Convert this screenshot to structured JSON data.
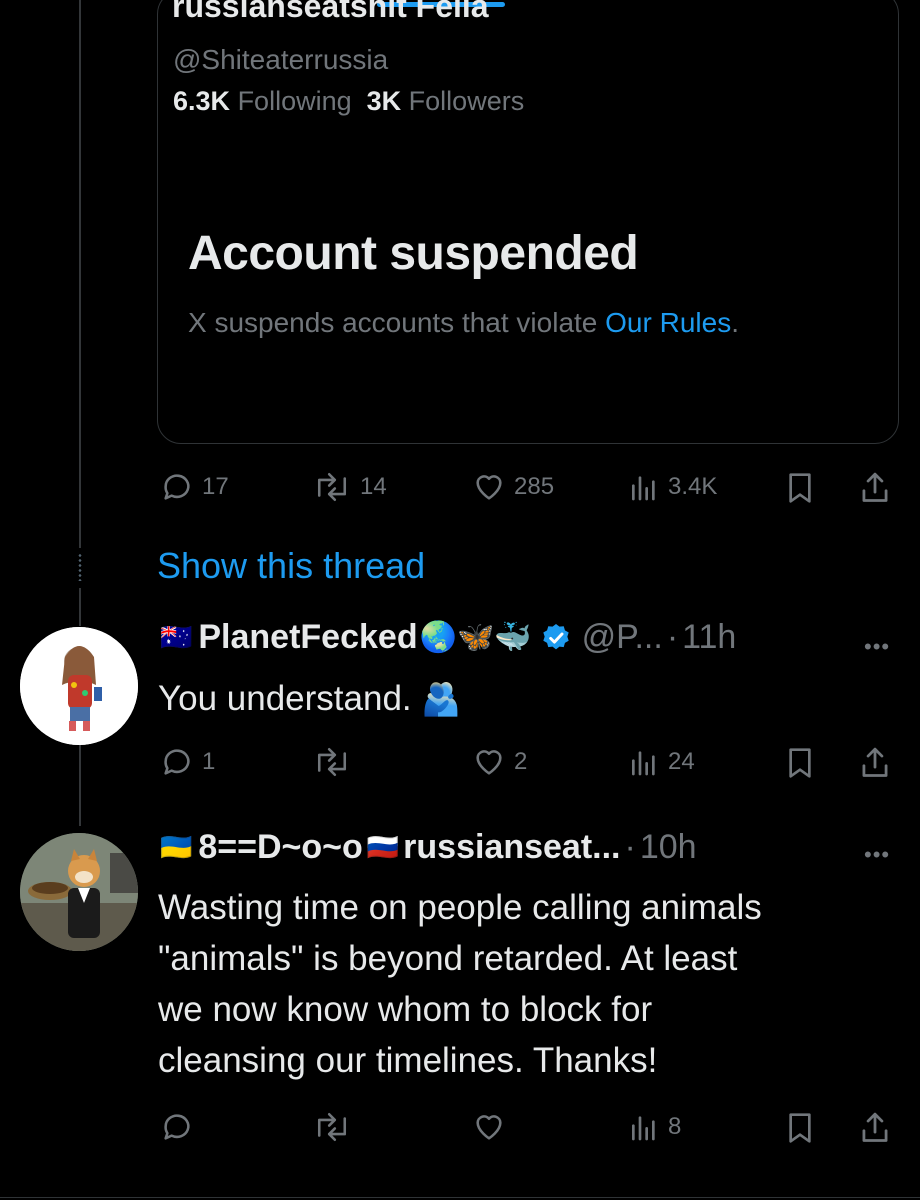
{
  "quoted": {
    "name": "russianseatshit Fella",
    "handle": "@Shiteaterrussia",
    "following_count": "6.3K",
    "following_label": "Following",
    "followers_count": "3K",
    "followers_label": "Followers",
    "suspended_title": "Account suspended",
    "suspended_desc": "X suspends accounts that violate ",
    "rules_link": "Our Rules",
    "rules_period": "."
  },
  "tweet1_actions": {
    "replies": "17",
    "reposts": "14",
    "likes": "285",
    "views": "3.4K"
  },
  "show_thread": "Show this thread",
  "reply1": {
    "flag": "🇦🇺",
    "name": "PlanetFecked",
    "emojis": "🌏🦋🐳",
    "handle": "@P...",
    "separator": "·",
    "time": "11h",
    "text": "You understand.",
    "text_emoji": "🫂",
    "actions": {
      "replies": "1",
      "reposts": "",
      "likes": "2",
      "views": "24"
    }
  },
  "reply2": {
    "flag_left": "🇺🇦",
    "name": "8==D~o~o",
    "flag_right": "🇷🇺",
    "name_rest": "russianseat...",
    "separator": "·",
    "time": "10h",
    "text_lines": [
      "Wasting time on people calling animals",
      "\"animals\" is beyond retarded. At least",
      "we now know whom to block for",
      "cleansing our timelines. Thanks!"
    ],
    "actions": {
      "replies": "",
      "reposts": "",
      "likes": "",
      "views": "8"
    }
  },
  "colors": {
    "background": "#000000",
    "text": "#e7e9ea",
    "muted": "#71767b",
    "accent": "#1d9bf0",
    "border": "#2f3336",
    "verified": "#1d9bf0"
  },
  "icons": [
    "reply-icon",
    "repost-icon",
    "like-icon",
    "views-icon",
    "bookmark-icon",
    "share-icon",
    "more-icon",
    "verified-badge-icon"
  ]
}
